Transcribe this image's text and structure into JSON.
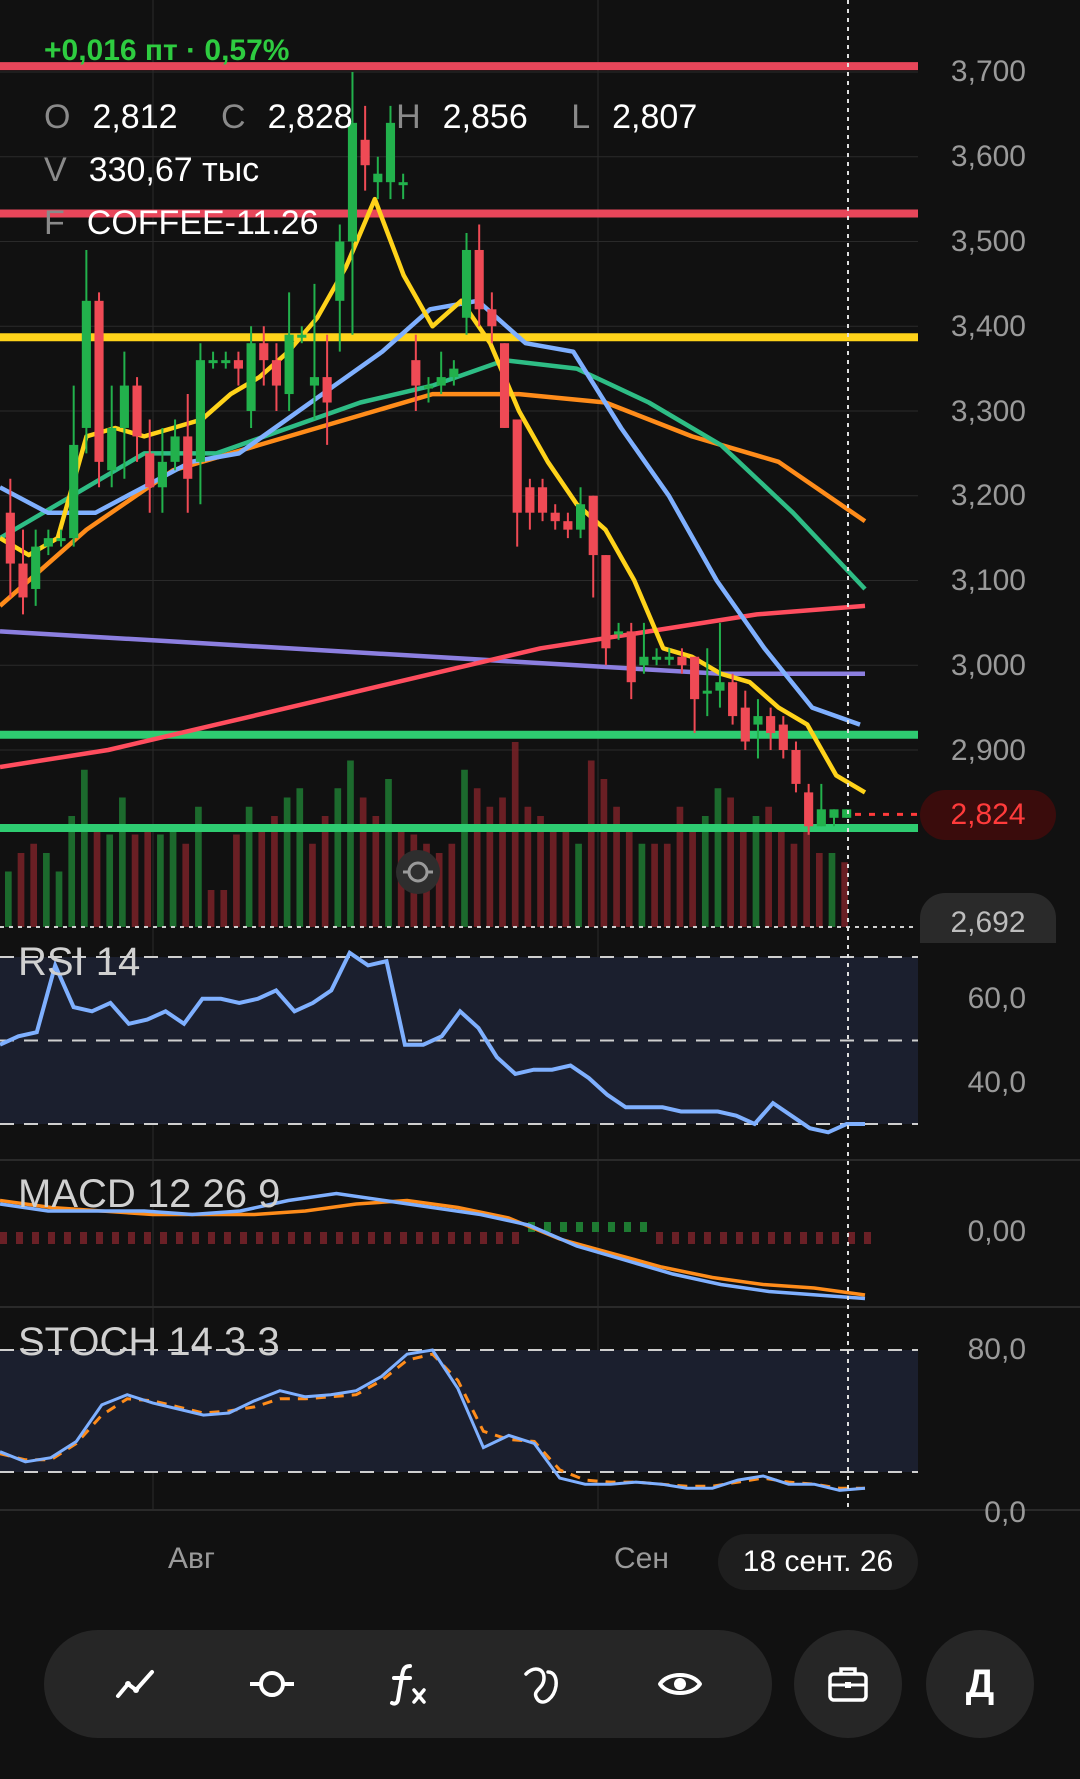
{
  "header": {
    "change": "+0,016 пт · 0,57%",
    "ohlc": [
      {
        "key": "O",
        "value": "2,812"
      },
      {
        "key": "C",
        "value": "2,828"
      },
      {
        "key": "H",
        "value": "2,856"
      },
      {
        "key": "L",
        "value": "2,807"
      }
    ],
    "volume": {
      "key": "V",
      "value": "330,67 тыс"
    },
    "symbol": {
      "key": "F",
      "value": "COFFEE-11.26"
    }
  },
  "price_axis": [
    "3,700",
    "3,600",
    "3,500",
    "3,400",
    "3,300",
    "3,200",
    "3,100",
    "3,000",
    "2,900"
  ],
  "current_price": "2,824",
  "lower_price": "2,692",
  "panels": {
    "rsi": {
      "title": "RSI 14",
      "ticks": [
        "60,0",
        "40,0"
      ]
    },
    "macd": {
      "title": "MACD 12 26 9",
      "ticks": [
        "0,00"
      ]
    },
    "stoch": {
      "title": "STOCH 14 3 3",
      "ticks": [
        "80,0",
        "0,0"
      ]
    }
  },
  "x_axis": {
    "labels": [
      "Авг",
      "Сен"
    ],
    "cursor_date": "18 сент. 26"
  },
  "toolbar": {
    "tools": [
      "trend-line-icon",
      "indicator-circle-icon",
      "function-icon",
      "drawing-tool-icon",
      "eye-icon"
    ],
    "portfolio_icon": "briefcase-icon",
    "account_letter": "Д"
  },
  "colors": {
    "up": "#22b14c",
    "down": "#ef4a55",
    "level_red": "#e8465a",
    "level_yellow": "#ffd31a",
    "level_green": "#2ecc71",
    "ma_yellow": "#ffd31a",
    "ma_blue": "#7fb0ff",
    "ma_green": "#2ebd85",
    "ma_orange": "#ff8c1a",
    "ma_red": "#ff4d5e",
    "ma_purple": "#8c7fe0"
  },
  "chart_data": {
    "type": "candlestick",
    "symbol": "COFFEE-11.26",
    "y_range": [
      2.65,
      3.72
    ],
    "horizontal_levels": [
      {
        "value": 3.707,
        "color": "red"
      },
      {
        "value": 3.533,
        "color": "red"
      },
      {
        "value": 3.387,
        "color": "yellow"
      },
      {
        "value": 2.918,
        "color": "green"
      },
      {
        "value": 2.808,
        "color": "green"
      }
    ],
    "candles": [
      [
        3.18,
        3.12,
        3.22,
        3.08
      ],
      [
        3.12,
        3.08,
        3.16,
        3.06
      ],
      [
        3.09,
        3.14,
        3.16,
        3.07
      ],
      [
        3.14,
        3.15,
        3.16,
        3.13
      ],
      [
        3.15,
        3.15,
        3.16,
        3.14
      ],
      [
        3.15,
        3.26,
        3.33,
        3.14
      ],
      [
        3.28,
        3.43,
        3.49,
        3.25
      ],
      [
        3.43,
        3.24,
        3.44,
        3.21
      ],
      [
        3.23,
        3.28,
        3.33,
        3.21
      ],
      [
        3.28,
        3.33,
        3.37,
        3.22
      ],
      [
        3.33,
        3.27,
        3.34,
        3.24
      ],
      [
        3.25,
        3.21,
        3.29,
        3.18
      ],
      [
        3.21,
        3.24,
        3.28,
        3.18
      ],
      [
        3.24,
        3.27,
        3.29,
        3.23
      ],
      [
        3.27,
        3.22,
        3.32,
        3.18
      ],
      [
        3.24,
        3.36,
        3.38,
        3.19
      ],
      [
        3.36,
        3.36,
        3.37,
        3.35
      ],
      [
        3.36,
        3.36,
        3.37,
        3.35
      ],
      [
        3.36,
        3.35,
        3.37,
        3.33
      ],
      [
        3.3,
        3.38,
        3.4,
        3.28
      ],
      [
        3.38,
        3.36,
        3.4,
        3.33
      ],
      [
        3.36,
        3.33,
        3.38,
        3.3
      ],
      [
        3.32,
        3.39,
        3.44,
        3.3
      ],
      [
        3.39,
        3.39,
        3.4,
        3.38
      ],
      [
        3.33,
        3.34,
        3.45,
        3.29
      ],
      [
        3.34,
        3.31,
        3.39,
        3.26
      ],
      [
        3.43,
        3.5,
        3.52,
        3.37
      ],
      [
        3.5,
        3.64,
        3.7,
        3.39
      ],
      [
        3.62,
        3.59,
        3.66,
        3.56
      ],
      [
        3.57,
        3.58,
        3.6,
        3.55
      ],
      [
        3.57,
        3.64,
        3.66,
        3.55
      ],
      [
        3.57,
        3.57,
        3.58,
        3.55
      ],
      [
        3.36,
        3.33,
        3.39,
        3.3
      ],
      [
        3.33,
        3.33,
        3.34,
        3.31
      ],
      [
        3.33,
        3.34,
        3.37,
        3.32
      ],
      [
        3.34,
        3.35,
        3.36,
        3.33
      ],
      [
        3.41,
        3.49,
        3.51,
        3.39
      ],
      [
        3.49,
        3.42,
        3.52,
        3.4
      ],
      [
        3.42,
        3.4,
        3.44,
        3.38
      ],
      [
        3.38,
        3.28,
        3.38,
        3.28
      ],
      [
        3.29,
        3.18,
        3.29,
        3.14
      ],
      [
        3.21,
        3.18,
        3.22,
        3.16
      ],
      [
        3.21,
        3.18,
        3.22,
        3.17
      ],
      [
        3.18,
        3.17,
        3.19,
        3.16
      ],
      [
        3.17,
        3.16,
        3.18,
        3.15
      ],
      [
        3.16,
        3.19,
        3.21,
        3.15
      ],
      [
        3.2,
        3.13,
        3.2,
        3.08
      ],
      [
        3.13,
        3.02,
        3.13,
        3.0
      ],
      [
        3.04,
        3.04,
        3.05,
        3.03
      ],
      [
        3.04,
        2.98,
        3.05,
        2.96
      ],
      [
        3.0,
        3.01,
        3.05,
        2.99
      ],
      [
        3.01,
        3.01,
        3.02,
        3.0
      ],
      [
        3.01,
        3.01,
        3.02,
        3.0
      ],
      [
        3.01,
        3.0,
        3.02,
        2.99
      ],
      [
        3.01,
        2.96,
        3.01,
        2.92
      ],
      [
        2.97,
        2.97,
        3.02,
        2.94
      ],
      [
        2.97,
        2.98,
        3.05,
        2.95
      ],
      [
        2.98,
        2.94,
        2.99,
        2.93
      ],
      [
        2.95,
        2.91,
        2.97,
        2.9
      ],
      [
        2.93,
        2.94,
        2.96,
        2.89
      ],
      [
        2.94,
        2.92,
        2.95,
        2.9
      ],
      [
        2.93,
        2.9,
        2.94,
        2.89
      ],
      [
        2.9,
        2.86,
        2.91,
        2.85
      ],
      [
        2.85,
        2.81,
        2.86,
        2.8
      ],
      [
        2.81,
        2.83,
        2.86,
        2.81
      ],
      [
        2.82,
        2.83,
        2.83,
        2.81
      ],
      [
        2.82,
        2.83,
        2.83,
        2.82
      ]
    ],
    "volume_up": [
      true,
      false,
      false,
      true,
      true,
      true,
      true,
      false,
      true,
      true,
      false,
      false,
      true,
      true,
      false,
      true,
      false,
      false,
      false,
      true,
      false,
      false,
      true,
      true,
      false,
      false,
      true,
      true,
      false,
      false,
      true,
      false,
      false,
      false,
      false,
      false,
      true,
      false,
      false,
      false,
      false,
      false,
      false,
      false,
      false,
      true,
      false,
      false,
      false,
      false,
      true,
      false,
      false,
      false,
      false,
      true,
      true,
      false,
      false,
      true,
      false,
      false,
      false,
      false,
      false,
      true,
      false
    ],
    "volume": [
      0.3,
      0.4,
      0.45,
      0.4,
      0.3,
      0.6,
      0.85,
      0.55,
      0.5,
      0.7,
      0.5,
      0.55,
      0.5,
      0.55,
      0.45,
      0.65,
      0.2,
      0.2,
      0.5,
      0.65,
      0.55,
      0.6,
      0.7,
      0.75,
      0.45,
      0.6,
      0.75,
      0.9,
      0.7,
      0.6,
      0.8,
      0.55,
      0.5,
      0.45,
      0.4,
      0.45,
      0.85,
      0.75,
      0.65,
      0.7,
      1.0,
      0.65,
      0.6,
      0.55,
      0.55,
      0.45,
      0.9,
      0.8,
      0.65,
      0.55,
      0.45,
      0.45,
      0.45,
      0.65,
      0.55,
      0.6,
      0.75,
      0.7,
      0.55,
      0.6,
      0.65,
      0.55,
      0.45,
      0.55,
      0.4,
      0.4,
      0.35
    ],
    "moving_averages": {
      "yellow": [
        3.15,
        3.13,
        3.15,
        3.27,
        3.28,
        3.27,
        3.28,
        3.29,
        3.32,
        3.34,
        3.37,
        3.41,
        3.47,
        3.55,
        3.46,
        3.4,
        3.43,
        3.38,
        3.3,
        3.24,
        3.19,
        3.16,
        3.1,
        3.02,
        3.01,
        2.99,
        2.98,
        2.95,
        2.93,
        2.87,
        2.85
      ],
      "blue": [
        3.21,
        3.18,
        3.18,
        3.21,
        3.24,
        3.25,
        3.29,
        3.33,
        3.37,
        3.42,
        3.43,
        3.38,
        3.37,
        3.28,
        3.2,
        3.1,
        3.02,
        2.95,
        2.93
      ],
      "green": [
        3.15,
        3.2,
        3.25,
        3.25,
        3.28,
        3.31,
        3.33,
        3.36,
        3.35,
        3.31,
        3.26,
        3.18,
        3.09
      ],
      "orange": [
        3.07,
        3.16,
        3.23,
        3.26,
        3.29,
        3.32,
        3.32,
        3.31,
        3.27,
        3.24,
        3.17
      ],
      "red": [
        2.88,
        2.9,
        2.93,
        2.96,
        2.99,
        3.02,
        3.04,
        3.06,
        3.07
      ],
      "purple": [
        3.04,
        3.03,
        3.02,
        3.01,
        3.0,
        2.99,
        2.99
      ]
    },
    "rsi": [
      49,
      51,
      52,
      68,
      58,
      57,
      59,
      54,
      55,
      57,
      54,
      60,
      60,
      59,
      60,
      62,
      57,
      59,
      62,
      71,
      68,
      69,
      49,
      49,
      51,
      57,
      53,
      46,
      42,
      43,
      43,
      44,
      41,
      37,
      34,
      34,
      34,
      33,
      33,
      33,
      32,
      30,
      35,
      32,
      29,
      28,
      30,
      30
    ],
    "stoch_k": [
      30,
      25,
      27,
      35,
      53,
      58,
      54,
      51,
      48,
      49,
      55,
      60,
      57,
      58,
      60,
      67,
      78,
      80,
      61,
      32,
      38,
      34,
      17,
      14,
      14,
      15,
      14,
      12,
      12,
      16,
      18,
      14,
      14,
      11,
      12
    ],
    "stoch_d": [
      29,
      26,
      26,
      34,
      48,
      56,
      55,
      52,
      49,
      50,
      52,
      56,
      56,
      57,
      58,
      65,
      75,
      78,
      65,
      40,
      36,
      35,
      21,
      16,
      15,
      15,
      14,
      13,
      13,
      15,
      17,
      15,
      14,
      12,
      12
    ],
    "macd": [
      0.04,
      0.03,
      0.03,
      0.03,
      0.025,
      0.03,
      0.045,
      0.055,
      0.045,
      0.035,
      0.025,
      0.01,
      -0.02,
      -0.04,
      -0.06,
      -0.075,
      -0.085,
      -0.09,
      -0.095
    ],
    "macd_signal": [
      0.045,
      0.035,
      0.03,
      0.025,
      0.025,
      0.025,
      0.03,
      0.04,
      0.045,
      0.035,
      0.02,
      -0.01,
      -0.03,
      -0.05,
      -0.065,
      -0.075,
      -0.08,
      -0.09
    ]
  }
}
